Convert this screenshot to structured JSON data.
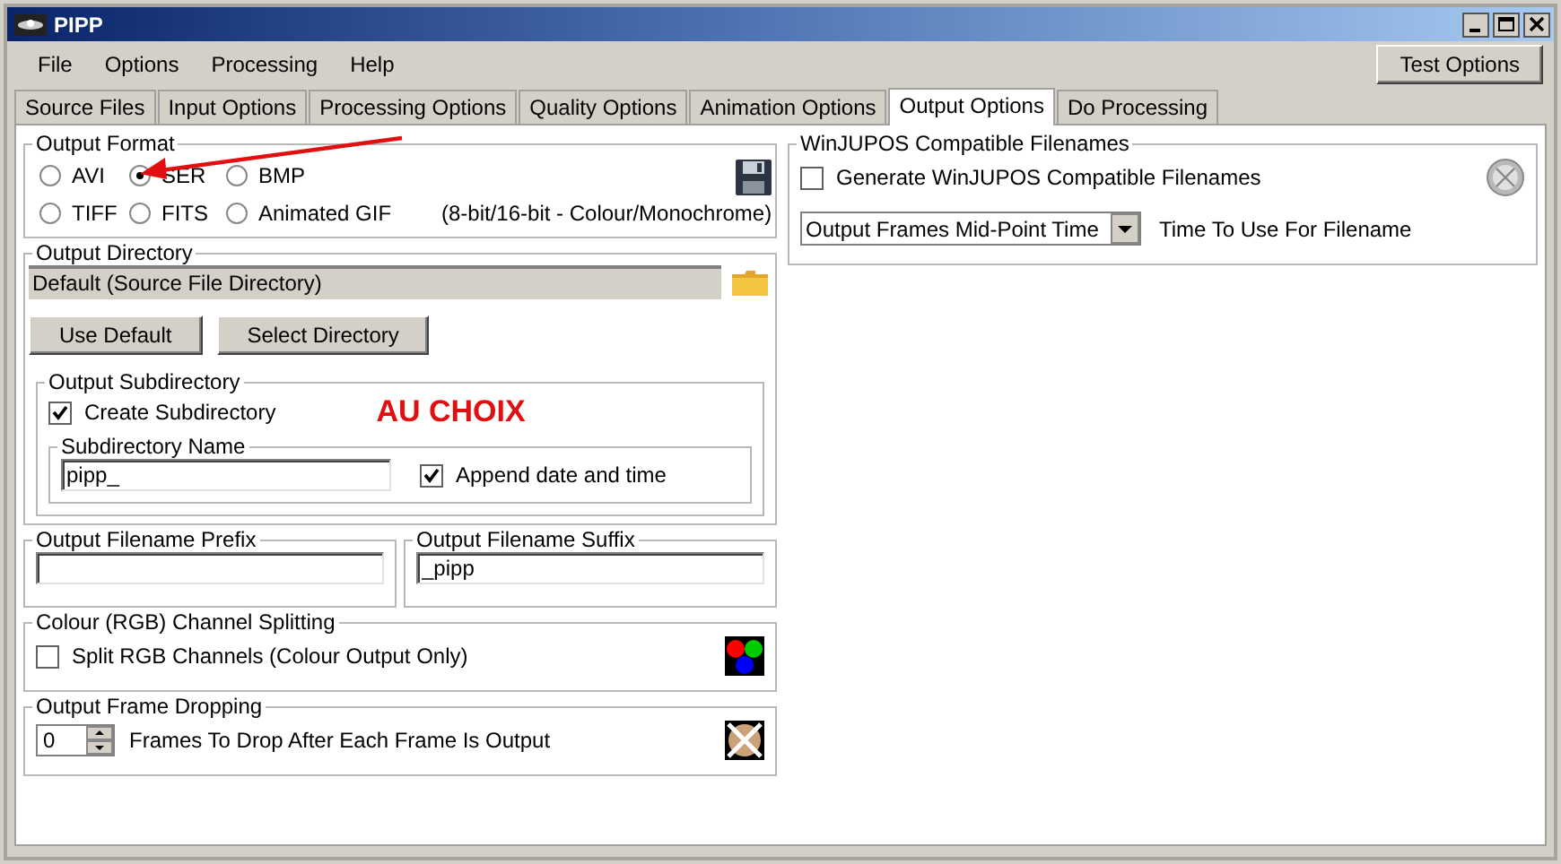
{
  "window": {
    "title": "PIPP"
  },
  "menu": [
    "File",
    "Options",
    "Processing",
    "Help"
  ],
  "toolbar": {
    "button": "Test Options"
  },
  "tabs": [
    {
      "label": "Source Files",
      "selected": false
    },
    {
      "label": "Input Options",
      "selected": false
    },
    {
      "label": "Processing Options",
      "selected": false
    },
    {
      "label": "Quality Options",
      "selected": false
    },
    {
      "label": "Animation Options",
      "selected": false
    },
    {
      "label": "Output Options",
      "selected": true
    },
    {
      "label": "Do Processing",
      "selected": false
    }
  ],
  "output_format": {
    "title": "Output Format",
    "formats": [
      {
        "label": "AVI",
        "selected": false
      },
      {
        "label": "SER",
        "selected": true
      },
      {
        "label": "BMP",
        "selected": false
      },
      {
        "label": "TIFF",
        "selected": false
      },
      {
        "label": "FITS",
        "selected": false
      },
      {
        "label": "Animated GIF",
        "selected": false
      }
    ],
    "note": "(8-bit/16-bit - Colour/Monochrome)"
  },
  "output_directory": {
    "title": "Output Directory",
    "path": "Default (Source File Directory)",
    "buttons": [
      "Use Default",
      "Select Directory"
    ],
    "subdirectory": {
      "title": "Output Subdirectory",
      "create": {
        "label": "Create Subdirectory",
        "checked": true
      },
      "annotation": "AU CHOIX",
      "name_group": {
        "title": "Subdirectory Name",
        "value": "pipp_",
        "append": {
          "label": "Append date and time",
          "checked": true
        }
      }
    }
  },
  "prefix": {
    "title": "Output Filename Prefix"
  },
  "suffix": {
    "title": "Output Filename Suffix",
    "value": "_pipp"
  },
  "splitting": {
    "title": "Colour (RGB) Channel Splitting",
    "checkbox": {
      "label": "Split RGB Channels (Colour Output Only)",
      "checked": false
    }
  },
  "dropping": {
    "title": "Output Frame Dropping",
    "value": "0",
    "label": "Frames To Drop After Each Frame Is Output"
  },
  "winjupos": {
    "title": "WinJUPOS Compatible Filenames",
    "checkbox": {
      "label": "Generate WinJUPOS Compatible Filenames",
      "checked": false
    },
    "select_value": "Output Frames Mid-Point Time",
    "select_label": "Time To Use For Filename"
  }
}
